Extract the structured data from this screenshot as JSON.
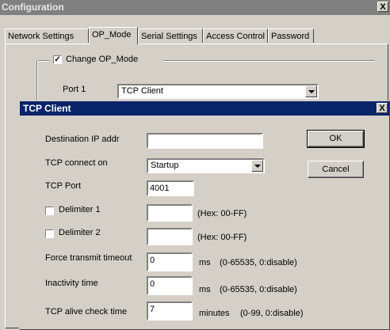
{
  "window": {
    "title": "Configuration",
    "close_glyph": "X"
  },
  "tabs": [
    {
      "label": "Network Settings"
    },
    {
      "label": "OP_Mode"
    },
    {
      "label": "Serial Settings"
    },
    {
      "label": "Access Control"
    },
    {
      "label": "Password"
    }
  ],
  "op_mode": {
    "change_label": "Change OP_Mode",
    "change_checked": true,
    "check_glyph": "✓",
    "port_label": "Port 1",
    "port_value": "TCP Client"
  },
  "dialog": {
    "title": "TCP Client",
    "close_glyph": "X",
    "dest_ip_label": "Destination IP addr",
    "dest_ip_value": "",
    "connect_on_label": "TCP connect on",
    "connect_on_value": "Startup",
    "tcp_port_label": "TCP Port",
    "tcp_port_value": "4001",
    "delimiter1_label": "Delimiter 1",
    "delimiter1_value": "",
    "delimiter1_hint": "(Hex: 00-FF)",
    "delimiter2_label": "Delimiter 2",
    "delimiter2_value": "",
    "delimiter2_hint": "(Hex: 00-FF)",
    "force_timeout_label": "Force transmit timeout",
    "force_timeout_value": "0",
    "force_timeout_unit": "ms",
    "force_timeout_hint": "(0-65535, 0:disable)",
    "inactivity_label": "Inactivity time",
    "inactivity_value": "0",
    "inactivity_unit": "ms",
    "inactivity_hint": "(0-65535, 0:disable)",
    "alive_label": "TCP alive check time",
    "alive_value": "7",
    "alive_unit": "minutes",
    "alive_hint": "(0-99, 0:disable)",
    "ok_label": "OK",
    "cancel_label": "Cancel"
  }
}
